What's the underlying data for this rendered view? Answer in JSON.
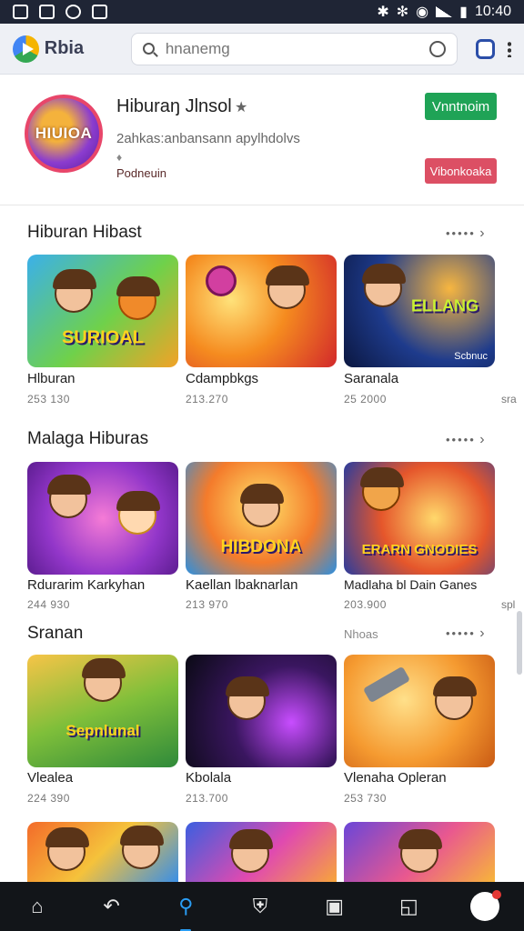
{
  "status_bar": {
    "time": "10:40"
  },
  "top_bar": {
    "app_name": "Rbia",
    "search_placeholder": "hnanemg"
  },
  "featured": {
    "icon_text": "HIUIOA",
    "title": "Hiburaŋ Jlnsol",
    "description": "2ahkas:anbansann apylhdolvs",
    "developer": "Podneuin",
    "primary_button": "Vnntnoim",
    "secondary_button": "Vibonkoaka"
  },
  "sections": [
    {
      "title": "Hiburan Hibast",
      "more": "•••••",
      "items": [
        {
          "label": "Hlburan",
          "sub": "253 130",
          "caption": "SURIOAL",
          "badge": ""
        },
        {
          "label": "Cdampbkgs",
          "sub": "213.270",
          "caption": "",
          "badge": ""
        },
        {
          "label": "Saranala",
          "sub": "25 2000",
          "caption": "ELLANG",
          "badge": "Scbnuc"
        }
      ],
      "edge_sub": "sra"
    },
    {
      "title": "Malaga Hiburas",
      "more": "•••••",
      "items": [
        {
          "label": "Rdurarim Karkyhan",
          "sub": "244 930",
          "caption": "",
          "badge": ""
        },
        {
          "label": "Kaellan lbaknarlan",
          "sub": "213 970",
          "caption": "HIBDONA",
          "badge": ""
        },
        {
          "label": "Madlaha bl Dain Ganes",
          "sub": "203.900",
          "caption": "ERARN GNODIES",
          "badge": ""
        }
      ],
      "edge_sub": "spl"
    },
    {
      "title": "Sranan",
      "right_label": "Nhoas",
      "more": "•••••",
      "items": [
        {
          "label": "Vlealea",
          "sub": "224 390",
          "caption": "Sepnlunal",
          "badge": ""
        },
        {
          "label": "Kbolala",
          "sub": "213.700",
          "caption": "",
          "badge": ""
        },
        {
          "label": "Vlenaha Opleran",
          "sub": "253 730",
          "caption": "",
          "badge": ""
        }
      ]
    }
  ],
  "bottom_nav": [
    "home-icon",
    "back-icon",
    "search-icon",
    "shield-icon",
    "photo-icon",
    "box-icon",
    "avatar"
  ]
}
